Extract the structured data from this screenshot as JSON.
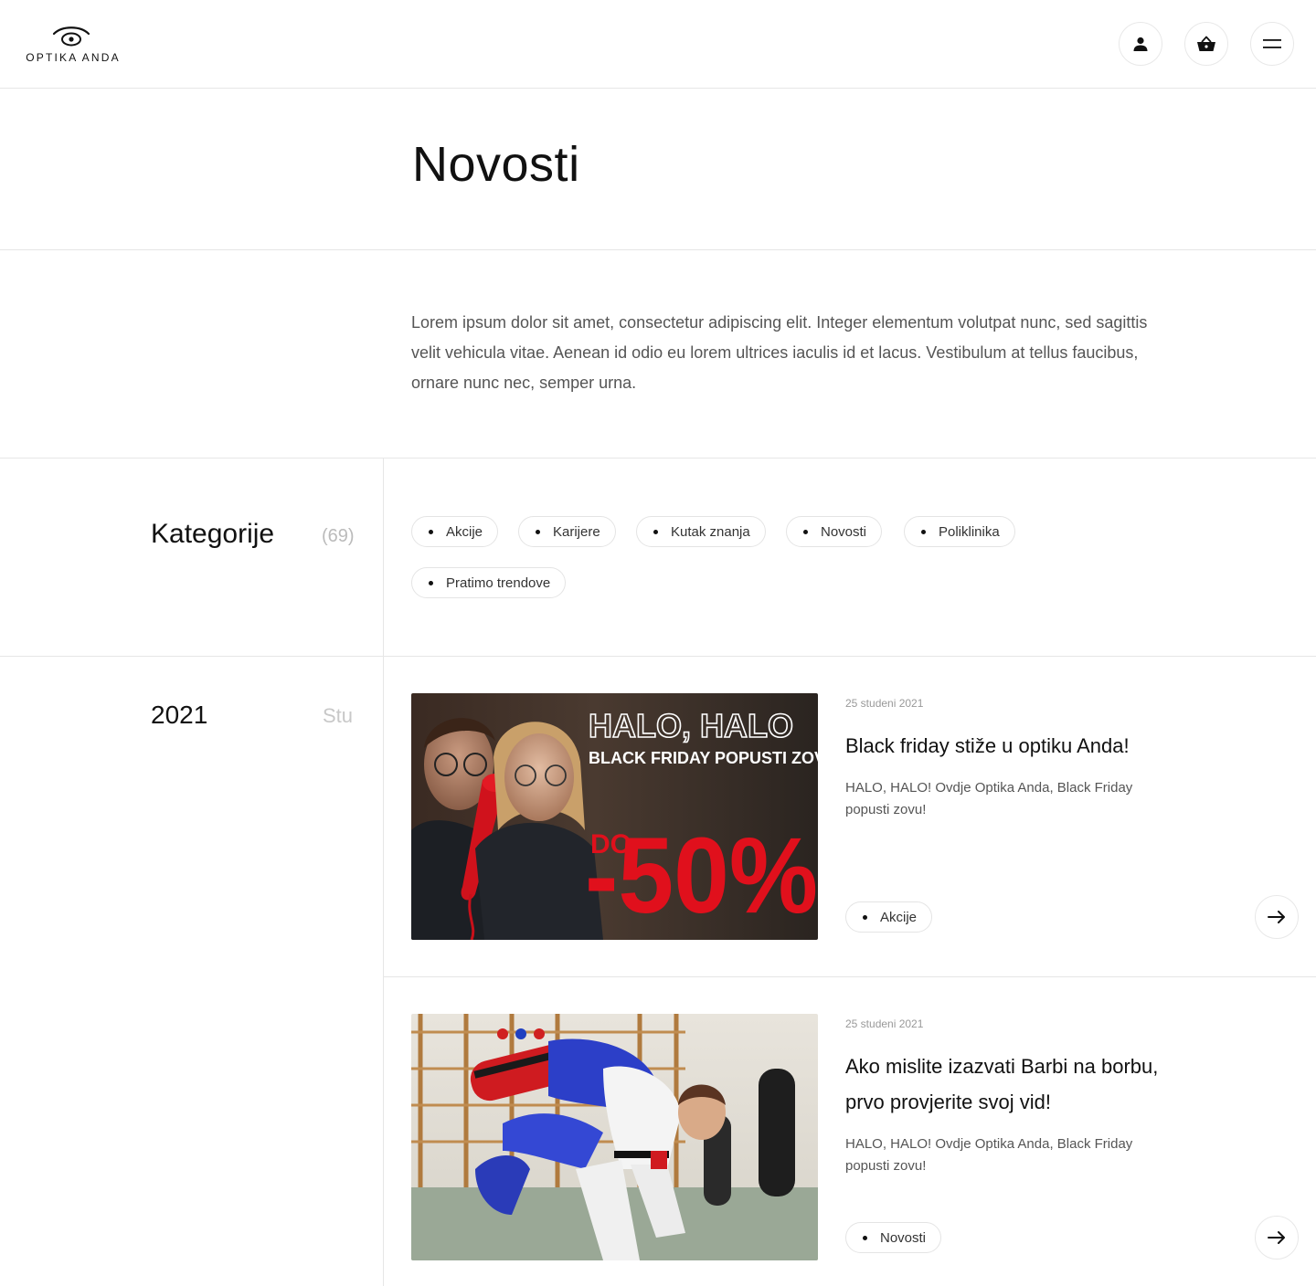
{
  "header": {
    "logo_text": "OPTIKA ANDA",
    "icons": [
      "user-icon",
      "basket-icon",
      "menu-icon"
    ]
  },
  "page": {
    "title": "Novosti",
    "intro": "Lorem ipsum dolor sit amet, consectetur adipiscing elit. Integer elementum volutpat nunc, sed sagittis velit vehicula vitae. Aenean id odio eu lorem ultrices iaculis id et lacus. Vestibulum at tellus faucibus, ornare nunc nec, semper urna."
  },
  "categories": {
    "label": "Kategorije",
    "count": "(69)",
    "items": [
      "Akcije",
      "Karijere",
      "Kutak znanja",
      "Novosti",
      "Poliklinika",
      "Pratimo trendove"
    ]
  },
  "archive": {
    "year": "2021",
    "month": "Stu"
  },
  "articles": [
    {
      "date": "25 studeni 2021",
      "title": "Black friday stiže u optiku Anda!",
      "excerpt": "HALO, HALO! Ovdje Optika Anda, Black Friday popusti zovu!",
      "category": "Akcije",
      "image": {
        "headline": "HALO, HALO",
        "subline": "BLACK FRIDAY POPUSTI ZOVU",
        "prefix": "DO",
        "discount": "-50%"
      }
    },
    {
      "date": "25 studeni 2021",
      "title": "Ako mislite izazvati Barbi na borbu, prvo provjerite svoj vid!",
      "excerpt": "HALO, HALO! Ovdje Optika Anda, Black Friday popusti zovu!",
      "category": "Novosti"
    }
  ],
  "colors": {
    "accent_red": "#e0101c",
    "border": "#e6e6e6",
    "text_muted": "#555555"
  }
}
